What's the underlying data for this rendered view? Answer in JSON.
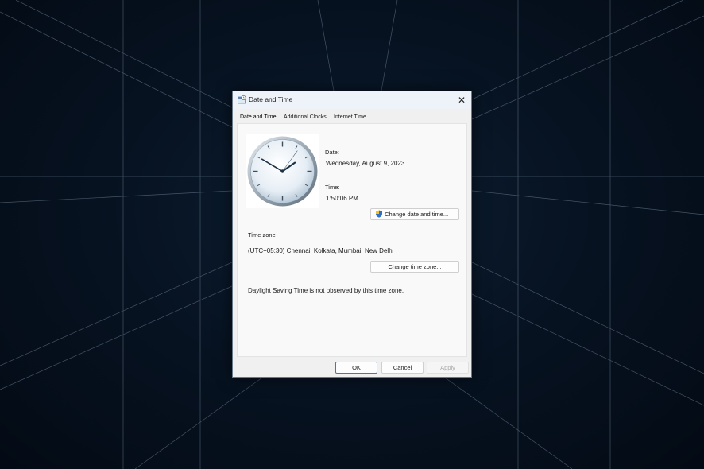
{
  "window": {
    "title": "Date and Time",
    "close_glyph": "✕"
  },
  "tabs": [
    {
      "label": "Date and Time",
      "active": true
    },
    {
      "label": "Additional Clocks",
      "active": false
    },
    {
      "label": "Internet Time",
      "active": false
    }
  ],
  "date_section": {
    "date_label": "Date:",
    "date_value": "Wednesday, August 9, 2023",
    "time_label": "Time:",
    "time_value": "1:50:06 PM",
    "change_button": "Change date and time...",
    "change_button_icon": "uac-shield-icon"
  },
  "clock": {
    "hours": 1,
    "minutes": 50,
    "seconds": 6
  },
  "timezone_section": {
    "group_label": "Time zone",
    "value": "(UTC+05:30) Chennai, Kolkata, Mumbai, New Delhi",
    "change_button": "Change time zone...",
    "dst_note": "Daylight Saving Time is not observed by this time zone."
  },
  "footer": {
    "ok": "OK",
    "cancel": "Cancel",
    "apply": "Apply"
  },
  "colors": {
    "accent": "#3c78c8",
    "background": "#071322"
  }
}
